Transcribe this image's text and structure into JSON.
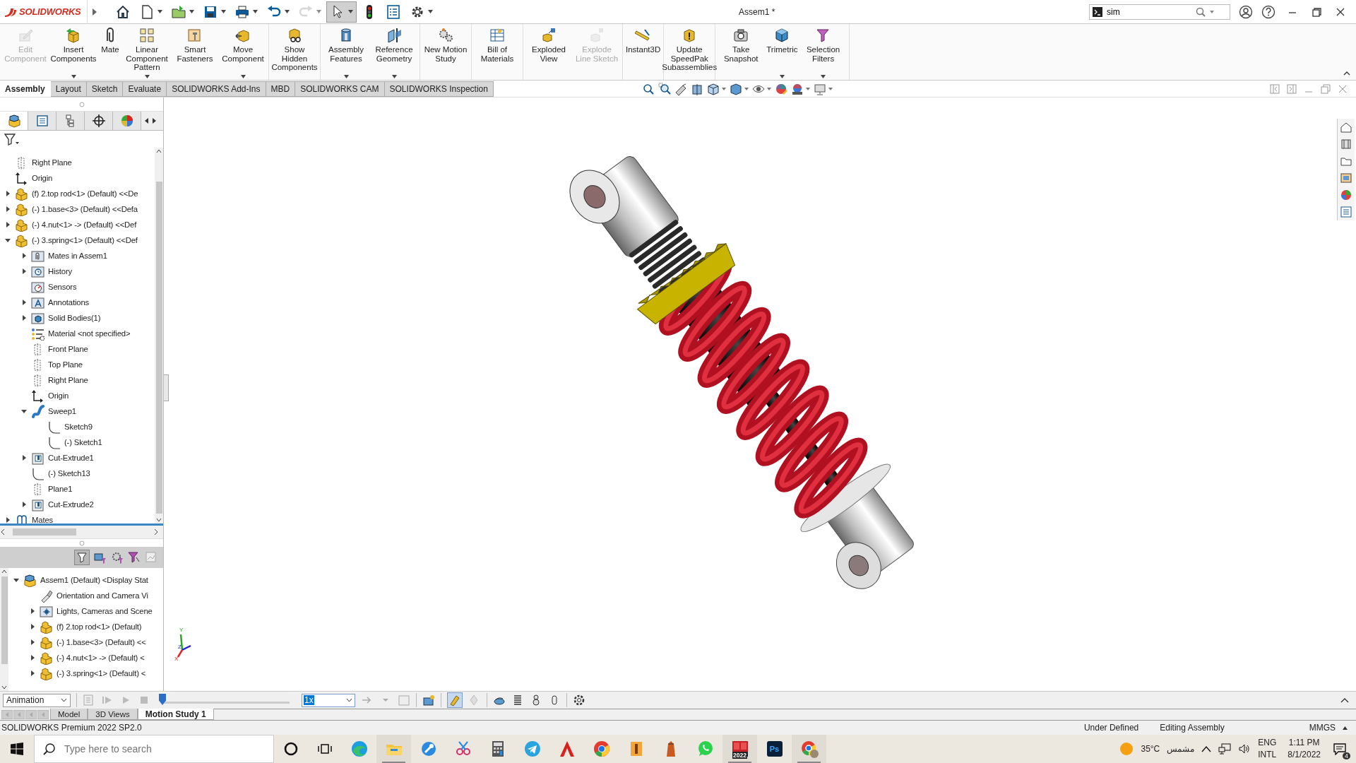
{
  "title_bar": {
    "logo": "SOLIDWORKS",
    "document_title": "Assem1 *",
    "search_value": "sim",
    "quick_access": [
      {
        "dropdown": false,
        "disabled": false,
        "pressed": false
      },
      {
        "dropdown": true,
        "disabled": false,
        "pressed": false
      },
      {
        "dropdown": true,
        "disabled": false,
        "pressed": false
      },
      {
        "dropdown": true,
        "disabled": false,
        "pressed": false
      },
      {
        "dropdown": true,
        "disabled": false,
        "pressed": false
      },
      {
        "dropdown": true,
        "disabled": false,
        "pressed": false
      },
      {
        "dropdown": true,
        "disabled": true,
        "pressed": false
      },
      {
        "dropdown": true,
        "disabled": false,
        "pressed": true
      },
      {
        "dropdown": false,
        "disabled": false,
        "pressed": false
      },
      {
        "dropdown": false,
        "disabled": false,
        "pressed": false
      },
      {
        "dropdown": true,
        "disabled": false,
        "pressed": false
      }
    ]
  },
  "ribbon": {
    "groups": [
      [
        {
          "label": "Edit Component",
          "disabled": true,
          "dropdown": false
        },
        {
          "label": "Insert Components",
          "disabled": false,
          "dropdown": true
        },
        {
          "label": "Mate",
          "disabled": false,
          "dropdown": false
        },
        {
          "label": "Linear Component Pattern",
          "disabled": false,
          "dropdown": true
        },
        {
          "label": "Smart Fasteners",
          "disabled": false,
          "dropdown": false
        },
        {
          "label": "Move Component",
          "disabled": false,
          "dropdown": true
        }
      ],
      [
        {
          "label": "Show Hidden Components",
          "disabled": false,
          "dropdown": false
        }
      ],
      [
        {
          "label": "Assembly Features",
          "disabled": false,
          "dropdown": true
        },
        {
          "label": "Reference Geometry",
          "disabled": false,
          "dropdown": true
        }
      ],
      [
        {
          "label": "New Motion Study",
          "disabled": false,
          "dropdown": false
        }
      ],
      [
        {
          "label": "Bill of Materials",
          "disabled": false,
          "dropdown": false
        }
      ],
      [
        {
          "label": "Exploded View",
          "disabled": false,
          "dropdown": false
        },
        {
          "label": "Explode Line Sketch",
          "disabled": true,
          "dropdown": false
        }
      ],
      [
        {
          "label": "Instant3D",
          "disabled": false,
          "dropdown": false
        }
      ],
      [
        {
          "label": "Update SpeedPak Subassemblies",
          "disabled": false,
          "dropdown": false
        }
      ],
      [
        {
          "label": "Take Snapshot",
          "disabled": false,
          "dropdown": false
        },
        {
          "label": "Trimetric",
          "disabled": false,
          "dropdown": true
        },
        {
          "label": "Selection Filters",
          "disabled": false,
          "dropdown": true
        }
      ]
    ]
  },
  "tabs": [
    {
      "label": "Assembly",
      "selected": true
    },
    {
      "label": "Layout",
      "selected": false
    },
    {
      "label": "Sketch",
      "selected": false
    },
    {
      "label": "Evaluate",
      "selected": false
    },
    {
      "label": "SOLIDWORKS Add-Ins",
      "selected": false
    },
    {
      "label": "MBD",
      "selected": false
    },
    {
      "label": "SOLIDWORKS CAM",
      "selected": false
    },
    {
      "label": "SOLIDWORKS Inspection",
      "selected": false
    }
  ],
  "manager_tabs": [
    {
      "selected": true
    },
    {
      "selected": false
    },
    {
      "selected": false
    },
    {
      "selected": false
    },
    {
      "selected": false
    }
  ],
  "feature_tree": {
    "items": [
      {
        "label": "Right Plane",
        "kind": "plane"
      },
      {
        "label": "Origin",
        "kind": "origin"
      },
      {
        "label": "(f) 2.top rod<1> (Default) <<De",
        "kind": "part",
        "expanded": false
      },
      {
        "label": "(-) 1.base<3> (Default) <<Defa",
        "kind": "part",
        "expanded": false
      },
      {
        "label": "(-) 4.nut<1> -> (Default) <<Def",
        "kind": "part",
        "expanded": false
      },
      {
        "label": "(-) 3.spring<1> (Default) <<Def",
        "kind": "part",
        "expanded": true,
        "children": [
          {
            "label": "Mates in Assem1",
            "kind": "mates-folder",
            "expanded": false
          },
          {
            "label": "History",
            "kind": "history",
            "expanded": false
          },
          {
            "label": "Sensors",
            "kind": "sensors"
          },
          {
            "label": "Annotations",
            "kind": "annotations",
            "expanded": false
          },
          {
            "label": "Solid Bodies(1)",
            "kind": "bodies",
            "expanded": false
          },
          {
            "label": "Material <not specified>",
            "kind": "material"
          },
          {
            "label": "Front Plane",
            "kind": "plane"
          },
          {
            "label": "Top Plane",
            "kind": "plane"
          },
          {
            "label": "Right Plane",
            "kind": "plane"
          },
          {
            "label": "Origin",
            "kind": "origin"
          },
          {
            "label": "Sweep1",
            "kind": "sweep",
            "expanded": true,
            "children": [
              {
                "label": "Sketch9",
                "kind": "sketch"
              },
              {
                "label": "(-) Sketch1",
                "kind": "sketch"
              }
            ]
          },
          {
            "label": "Cut-Extrude1",
            "kind": "cut",
            "expanded": false
          },
          {
            "label": "(-) Sketch13",
            "kind": "sketch"
          },
          {
            "label": "Plane1",
            "kind": "plane"
          },
          {
            "label": "Cut-Extrude2",
            "kind": "cut",
            "expanded": false
          }
        ]
      },
      {
        "label": "Mates",
        "kind": "mates",
        "expanded": false
      }
    ]
  },
  "motion_tree": {
    "items": [
      {
        "label": "Assem1 (Default) <Display Stat",
        "kind": "assembly",
        "expanded": true,
        "children": [
          {
            "label": "Orientation and Camera Vi",
            "kind": "camera"
          },
          {
            "label": "Lights, Cameras and Scene",
            "kind": "lights",
            "expanded": false
          },
          {
            "label": "(f) 2.top rod<1> (Default)",
            "kind": "part",
            "expanded": false
          },
          {
            "label": "(-) 1.base<3> (Default) <<",
            "kind": "part",
            "expanded": false
          },
          {
            "label": "(-) 4.nut<1> -> (Default) <",
            "kind": "part",
            "expanded": false
          },
          {
            "label": "(-) 3.spring<1> (Default) <",
            "kind": "part",
            "expanded": false
          }
        ]
      }
    ]
  },
  "viewport": {
    "triad": {
      "y": "Y",
      "z": "Z",
      "x": "X"
    }
  },
  "motion_study": {
    "study_type": "Animation",
    "timeline": {
      "level": 0
    },
    "speed": "1x",
    "tabs": [
      {
        "label": "Model",
        "selected": false
      },
      {
        "label": "3D Views",
        "selected": false
      },
      {
        "label": "Motion Study 1",
        "selected": true
      }
    ]
  },
  "status_bar": {
    "product": "SOLIDWORKS Premium 2022 SP2.0",
    "definition": "Under Defined",
    "mode": "Editing Assembly",
    "units": "MMGS"
  },
  "taskbar": {
    "search_placeholder": "Type here to search",
    "apps": [
      {
        "running": false
      },
      {
        "running": true
      },
      {
        "running": false
      },
      {
        "running": false
      },
      {
        "running": false
      },
      {
        "running": false
      },
      {
        "running": false
      },
      {
        "running": false
      },
      {
        "running": false
      },
      {
        "running": false
      },
      {
        "running": false
      },
      {
        "running": true,
        "badge": "2022"
      },
      {
        "running": false,
        "label": "Ps"
      },
      {
        "running": true
      }
    ],
    "weather": {
      "temperature": "35°C",
      "condition": "مشمس"
    },
    "language": {
      "input": "ENG",
      "layout": "INTL"
    },
    "time": "1:11 PM",
    "date": "8/1/2022",
    "notifications": "4"
  }
}
